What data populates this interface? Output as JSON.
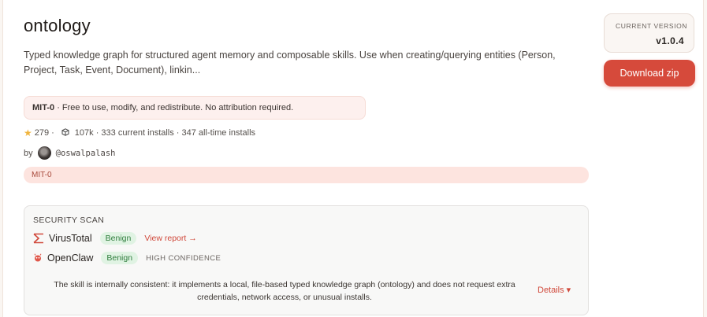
{
  "skill": {
    "title": "ontology",
    "description": "Typed knowledge graph for structured agent memory and composable skills. Use when creating/querying entities (Person, Project, Task, Event, Document), linkin...",
    "license_name": "MIT-0",
    "license_text": "· Free to use, modify, and redistribute. No attribution required.",
    "stars": "279",
    "stats_text": "107k · 333 current installs · 347 all-time installs",
    "by_label": "by",
    "author": "@oswalpalash",
    "tag": "MIT-0"
  },
  "security": {
    "heading": "SECURITY SCAN",
    "virustotal": {
      "name": "VirusTotal",
      "status": "Benign",
      "link": "View report →"
    },
    "openclaw": {
      "name": "OpenClaw",
      "status": "Benign",
      "confidence": "HIGH CONFIDENCE"
    },
    "verdict": "The skill is internally consistent: it implements a local, file-based typed knowledge graph (ontology) and does not request extra credentials, network access, or unusual installs.",
    "details_label": "Details ▾"
  },
  "sidebar": {
    "version_label": "CURRENT VERSION",
    "version_value": "v1.0.4",
    "download_label": "Download zip"
  },
  "colors": {
    "accent": "#d64a3b",
    "benign_bg": "#e0f3e3",
    "benign_fg": "#2f7d3d"
  }
}
